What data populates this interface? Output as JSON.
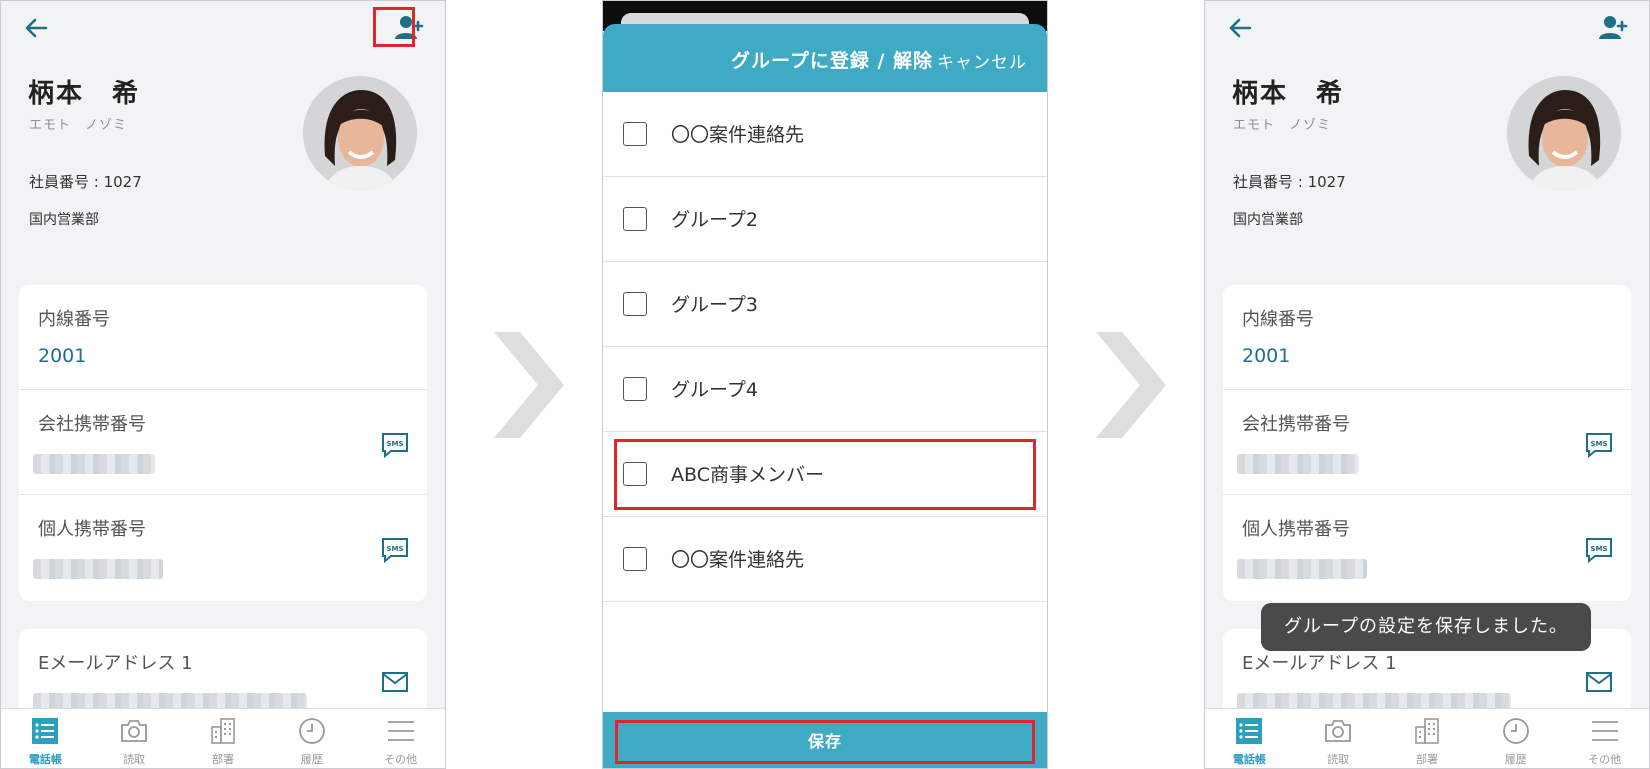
{
  "profile": {
    "name": "柄本　希",
    "kana": "エモト　ノゾミ",
    "employee_number": "社員番号 : 1027",
    "department": "国内営業部"
  },
  "fields": {
    "extension_label": "内線番号",
    "extension_value": "2001",
    "company_mobile_label": "会社携帯番号",
    "personal_mobile_label": "個人携帯番号",
    "email1_label": "Eメールアドレス 1",
    "sms_badge": "SMS"
  },
  "tabbar": {
    "tabs": [
      {
        "label": "電話帳",
        "icon": "phonebook-icon",
        "active": true
      },
      {
        "label": "読取",
        "icon": "camera-icon",
        "active": false
      },
      {
        "label": "部署",
        "icon": "building-icon",
        "active": false
      },
      {
        "label": "履歴",
        "icon": "clock-icon",
        "active": false
      },
      {
        "label": "その他",
        "icon": "menu-icon",
        "active": false
      }
    ]
  },
  "modal": {
    "title": "グループに登録 / 解除",
    "cancel_label": "キャンセル",
    "groups": [
      {
        "label": "〇〇案件連絡先",
        "checked": false
      },
      {
        "label": "グループ2",
        "checked": false
      },
      {
        "label": "グループ3",
        "checked": false
      },
      {
        "label": "グループ4",
        "checked": false
      },
      {
        "label": "ABC商事メンバー",
        "checked": false
      },
      {
        "label": "〇〇案件連絡先",
        "checked": false
      }
    ],
    "save_label": "保存"
  },
  "toast": {
    "message": "グループの設定を保存しました。"
  },
  "colors": {
    "accent": "#3eaac4",
    "link_text": "#1f6f86",
    "highlight": "#e0262d"
  }
}
